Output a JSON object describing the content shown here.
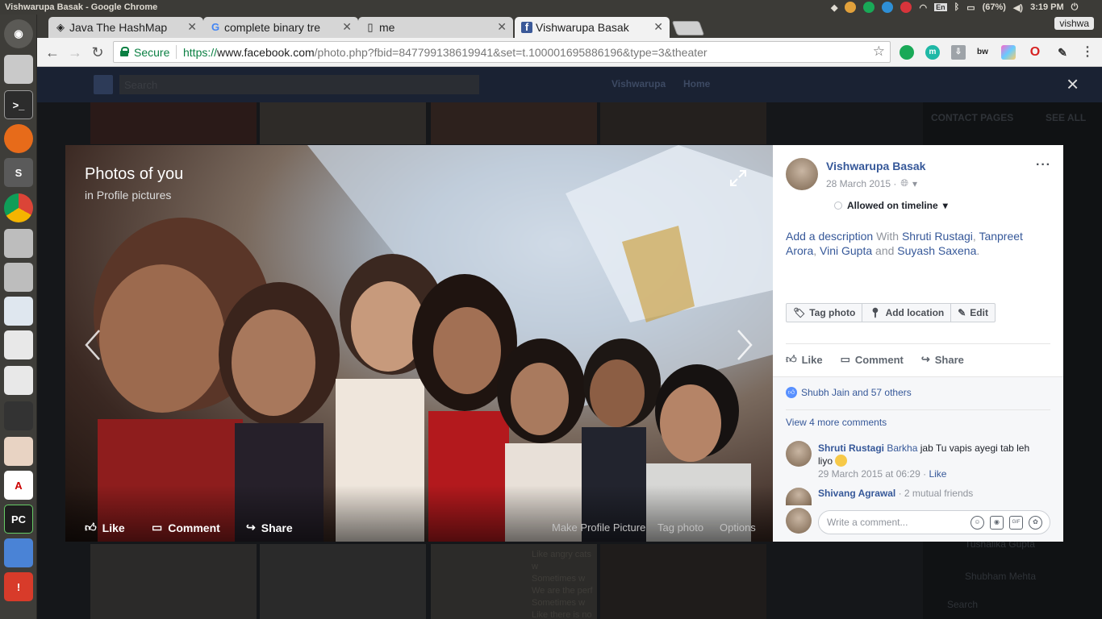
{
  "system": {
    "window_title": "Vishwarupa Basak - Google Chrome",
    "keyboard": "En",
    "battery": "(67%)",
    "time": "3:19 PM"
  },
  "browser": {
    "tabs": [
      {
        "label": "Java The HashMap",
        "icon": "site-icon"
      },
      {
        "label": "complete binary tre",
        "icon": "google-icon"
      },
      {
        "label": "me",
        "icon": "page-icon"
      },
      {
        "label": "Vishwarupa Basak",
        "icon": "facebook-icon"
      }
    ],
    "user_badge": "vishwa",
    "secure_label": "Secure",
    "url_scheme": "https://",
    "url_domain": "www.facebook.com",
    "url_path": "/photo.php?fbid=847799138619941&set=t.100001695886196&type=3&theater"
  },
  "facebook": {
    "search_placeholder": "Search",
    "profile_name": "Vishwarupa",
    "home_label": "Home",
    "close_glyph": "×",
    "contact_header": "CONTACT PAGES",
    "see_all": "SEE ALL",
    "chat_names": [
      "Tushalika Gupta",
      "Shubham Mehta"
    ],
    "chat_search": "Search",
    "bg_caption_lines": [
      "Like angry cats w",
      "Sometimes w",
      "We are the perf",
      "Sometimes w",
      "Like there is no"
    ]
  },
  "photo": {
    "album_title": "Photos of you",
    "album_sub": "in Profile pictures",
    "like": "Like",
    "comment": "Comment",
    "share": "Share",
    "make_profile": "Make Profile Picture",
    "tag_photo": "Tag photo",
    "options": "Options"
  },
  "post": {
    "owner": "Vishwarupa Basak",
    "date": "28 March 2015 ·",
    "more": "···",
    "allowed": "Allowed on timeline",
    "add_description": "Add a description",
    "with": " With ",
    "tagged": [
      "Shruti Rustagi",
      "Tanpreet Arora",
      "Vini Gupta",
      "Suyash Saxena"
    ],
    "comma1": ", ",
    "comma2": ", ",
    "and": " and ",
    "period": ".",
    "tag_photo_btn": "Tag photo",
    "add_location_btn": "Add location",
    "edit_btn": "Edit",
    "like": "Like",
    "comment": "Comment",
    "share": "Share",
    "likes_text": "Shubh Jain and 57 others",
    "view_more": "View 4 more comments",
    "comments": [
      {
        "author": "Shruti Rustagi",
        "tag": "Barkha",
        "text": " jab Tu vapis ayegi tab leh liyo ",
        "time": "29 March 2015 at 06:29",
        "sep": " · ",
        "like": "Like"
      },
      {
        "author": "Shivang Agrawal",
        "mutual": " · 2 mutual friends"
      }
    ],
    "write_placeholder": "Write a comment...",
    "gif_label": "GIF"
  },
  "colors": {
    "fb_blue": "#365899",
    "secure_green": "#0b8043",
    "like_blue": "#5890ff"
  }
}
